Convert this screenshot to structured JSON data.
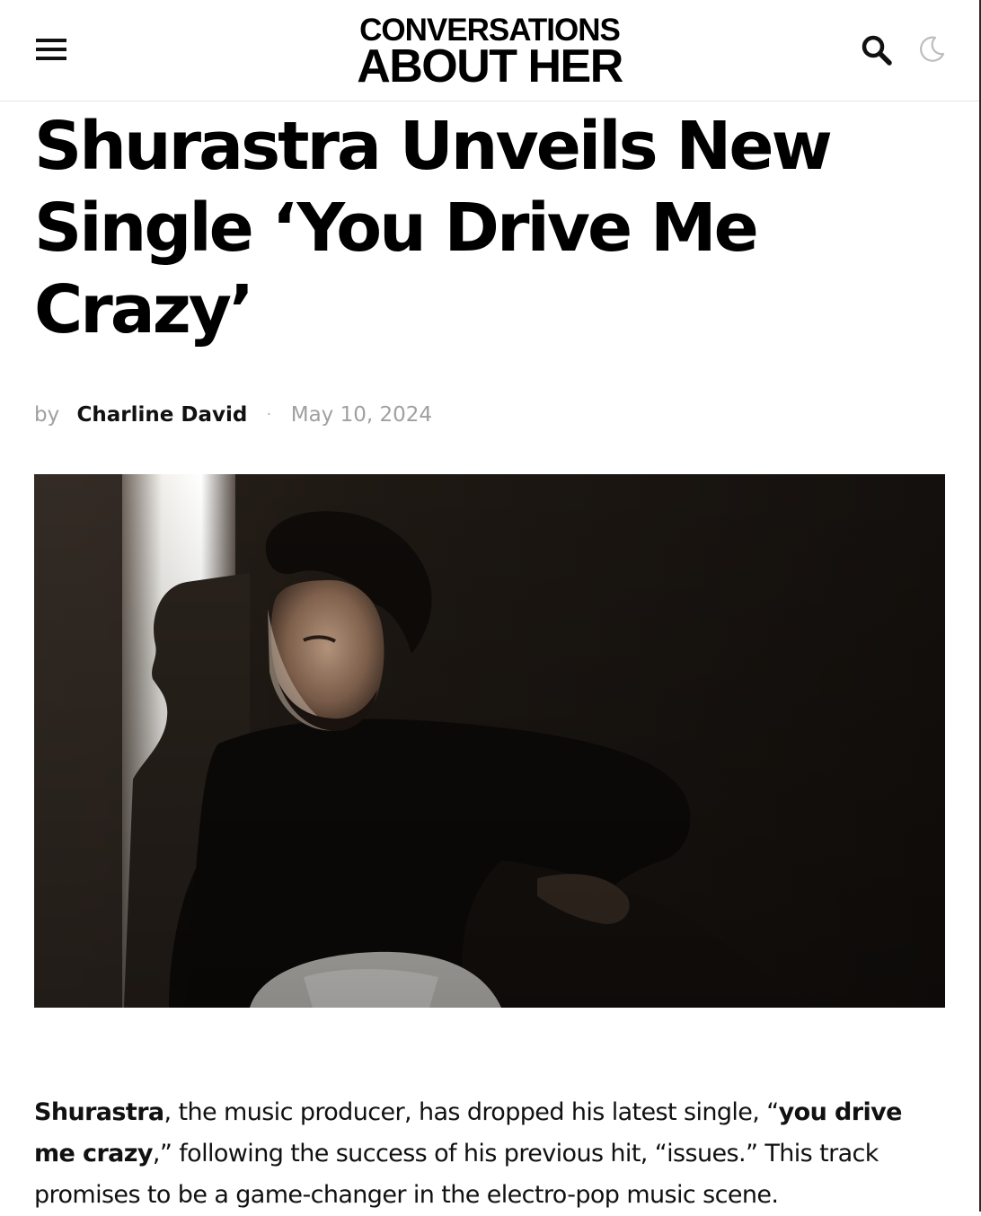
{
  "header": {
    "logo_line1": "CONVERSATIONS",
    "logo_line2": "ABOUT HER",
    "menu_icon": "hamburger-menu-icon",
    "search_icon": "search-icon",
    "theme_icon": "moon-icon"
  },
  "article": {
    "title": "Shurastra Unveils New Single ‘You Drive Me Crazy’",
    "byline_prefix": "by",
    "author": "Charline David",
    "separator": "·",
    "date": "May 10, 2024",
    "image_description": "man-portrait-in-shadow",
    "intro": {
      "artist": "Shurastra",
      "text1": ", the music producer, has dropped his latest single, “",
      "single": "you drive me crazy",
      "text2": ",” following the success of his previous hit, “issues.” This track promises to be a game-changer in the electro-pop music scene."
    }
  },
  "colors": {
    "text": "#000000",
    "muted": "#a0a0a0",
    "moon": "#bdbdbd",
    "hero_bg": "#1e1914"
  }
}
